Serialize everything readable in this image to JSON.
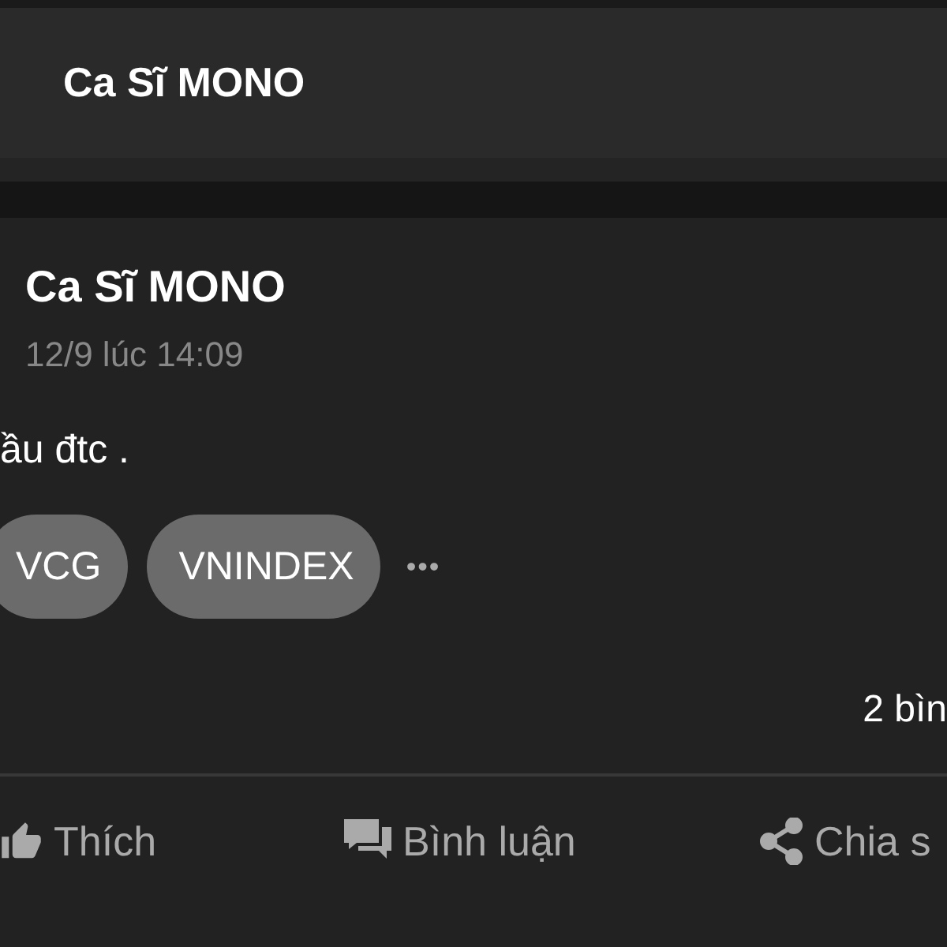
{
  "header": {
    "title": "Ca Sĩ MONO"
  },
  "post": {
    "author": "Ca Sĩ MONO",
    "time": "12/9 lúc 14:09",
    "body": "ầu đtc .",
    "tags": [
      "VCG",
      "VNINDEX"
    ],
    "more": "•••",
    "comments_count": "2 bìn"
  },
  "actions": [
    {
      "kind": "like",
      "label": "Thích"
    },
    {
      "kind": "comment",
      "label": "Bình luận"
    },
    {
      "kind": "share",
      "label": "Chia s"
    }
  ]
}
